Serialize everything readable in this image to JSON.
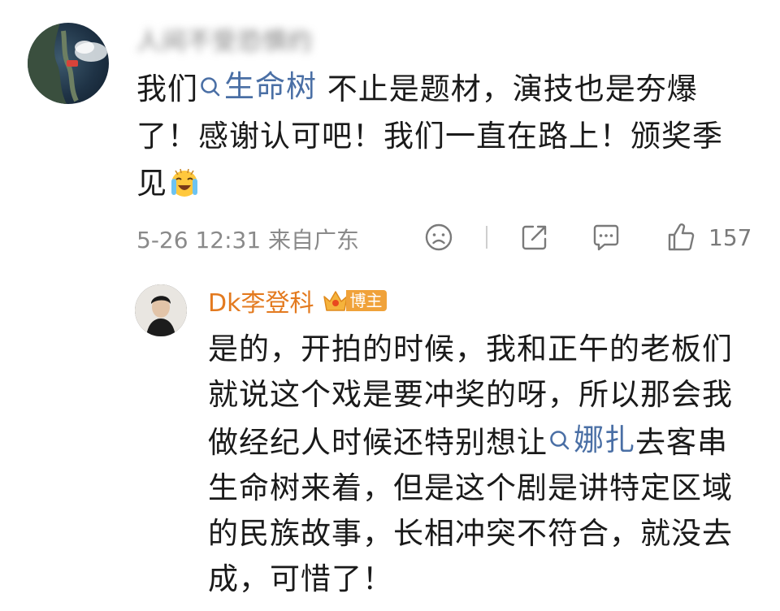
{
  "comment": {
    "username": "人间不受恐惧约",
    "text_before_topic": "我们",
    "topic": "生命树",
    "text_after_topic": " 不止是题材，演技也是夯爆了！感谢认可吧！我们一直在路上！颁奖季见",
    "emoji": "crying-laughing-emoji",
    "timestamp": "5-26 12:31",
    "location": "来自广东",
    "like_count": "157"
  },
  "reply": {
    "username": "Dk李登科",
    "badge_label": "博主",
    "text_before_mention": "是的，开拍的时候，我和正午的老板们就说这个戏是要冲奖的呀，所以那会我做经纪人时候还特别想让",
    "mention": "娜扎",
    "text_after_mention": "去客串生命树来着，但是这个剧是讲特定区域的民族故事，长相冲突不符合，就没去成，可惜了！"
  },
  "colors": {
    "link": "#4a6fa5",
    "reply_name": "#e37a1f",
    "badge": "#f0a23a",
    "meta_text": "#8a8a8a"
  }
}
